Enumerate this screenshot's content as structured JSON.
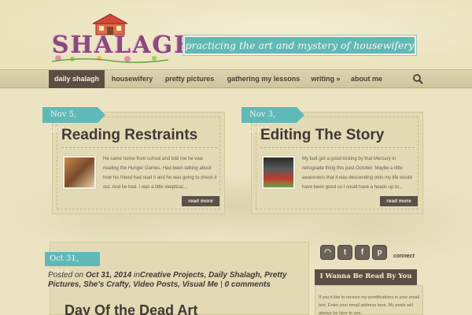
{
  "site": {
    "logo_text": "SHALAGH",
    "tagline": "practicing the art and mystery of housewifery"
  },
  "nav": {
    "items": [
      {
        "label": "daily shalagh",
        "active": true
      },
      {
        "label": "housewifery",
        "active": false
      },
      {
        "label": "pretty pictures",
        "active": false
      },
      {
        "label": "gathering my lessons",
        "active": false
      },
      {
        "label": "writing »",
        "active": false
      },
      {
        "label": "about me",
        "active": false
      }
    ],
    "search_icon": "search-icon"
  },
  "posts": [
    {
      "date": "Nov 5, 2014",
      "title": "Reading Restraints",
      "excerpt": "He came home from school and told me he was reading the Hunger Games. Had been talking about how his friend had read it and he was going to check it out. And he had. I was a little skeptical....",
      "more": "read more"
    },
    {
      "date": "Nov 3, 2014",
      "title": "Editing The Story",
      "excerpt": "My butt got a good kicking by that Mercury in retrograde thing this past October. Maybe a little awareness that it was descending onto my life would have been good so I could have a heads up to...",
      "more": "read more"
    }
  ],
  "featured": {
    "date": "Oct 31, 2014",
    "posted_on": "Posted on",
    "posted_date": "Oct 31, 2014",
    "in": "in",
    "categories": "Creative Projects, Daily Shalagh, Pretty Pictures, She's Crafty, Video Posts, Visual Me",
    "sep": "|",
    "comments": "0 comments",
    "title": "Day Of the Dead Art"
  },
  "sidebar": {
    "connect_label": "connect",
    "social": [
      "rss-icon",
      "twitter-icon",
      "facebook-icon",
      "pinterest-icon"
    ],
    "widget_title": "I Wanna Be Read By You",
    "widget_text": "If you'd like to receive my pontifications in your email box, Enter your email address here. My posts will always be here to see..."
  },
  "colors": {
    "accent": "#5fb9b9",
    "nav_active": "#5a4f44",
    "background": "#ece4bf"
  }
}
